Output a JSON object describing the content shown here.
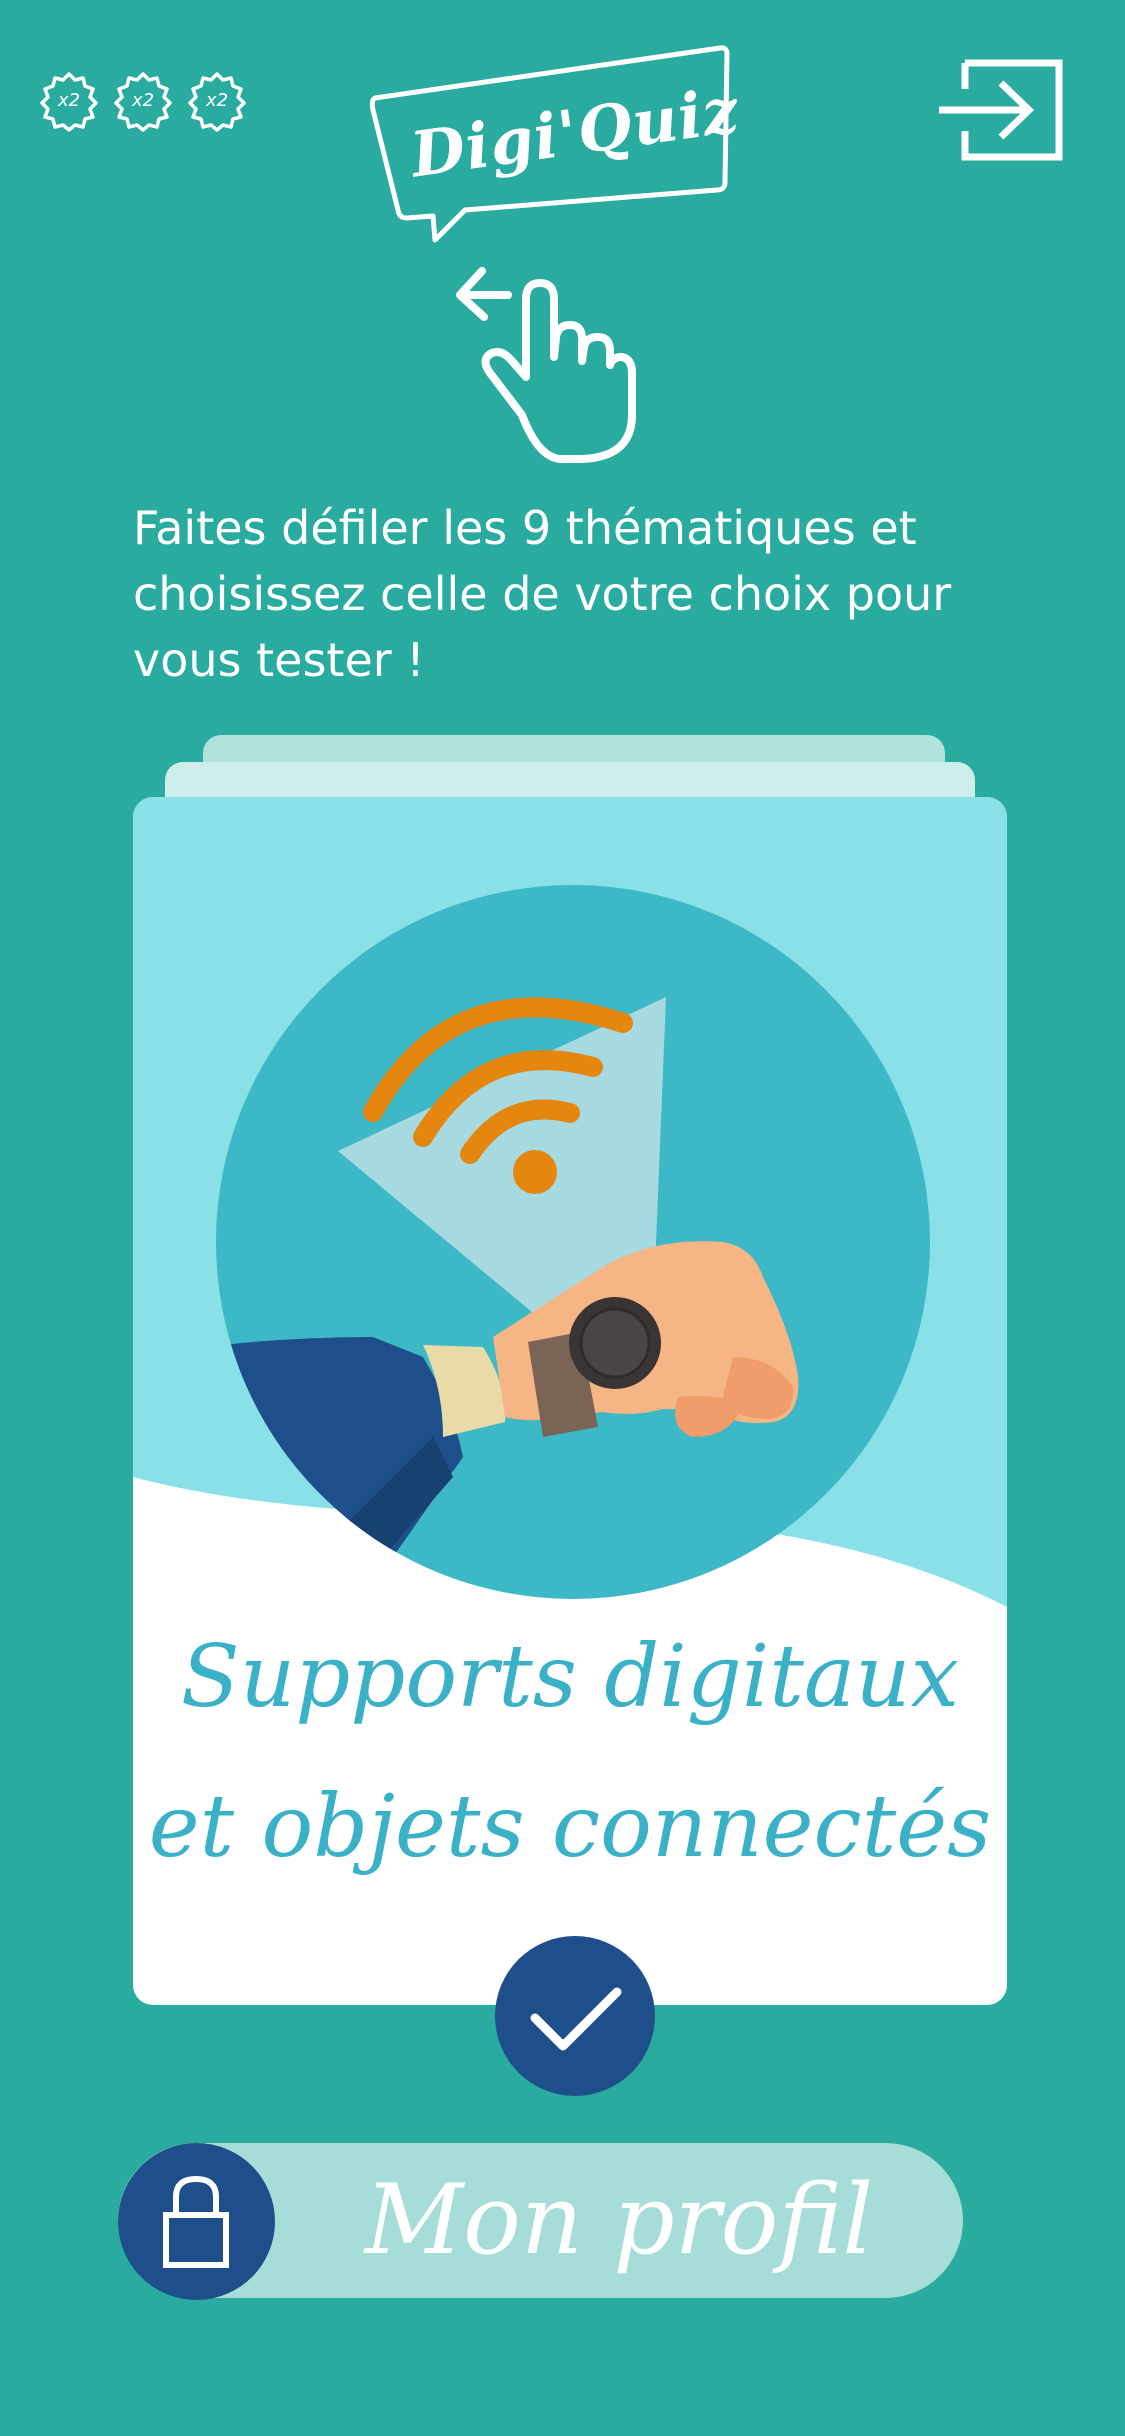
{
  "header": {
    "badges": [
      {
        "label": "x2"
      },
      {
        "label": "x2"
      },
      {
        "label": "x2"
      }
    ],
    "logo_text": "Digi'Quiz",
    "exit_icon": "sign-in-arrow-icon"
  },
  "instructions": "Faites défiler les 9 thématiques et choisissez celle de votre choix pour vous tester !",
  "swipe_icon": "swipe-left-hand-icon",
  "card": {
    "title_line1": "Supports digitaux",
    "title_line2": "et objets connectés",
    "illustration_icon": "smartwatch-wifi-icon",
    "confirm_icon": "checkmark-icon"
  },
  "profile": {
    "label": "Mon profil",
    "icon": "lock-icon"
  },
  "colors": {
    "background": "#2aab9f",
    "card_top": "#89e0e6",
    "circle": "#3db8c6",
    "navy": "#1e4f8a",
    "accent_orange": "#e5860f",
    "title_blue": "#3bb1c8",
    "profile_bar": "#a6ddd8"
  }
}
